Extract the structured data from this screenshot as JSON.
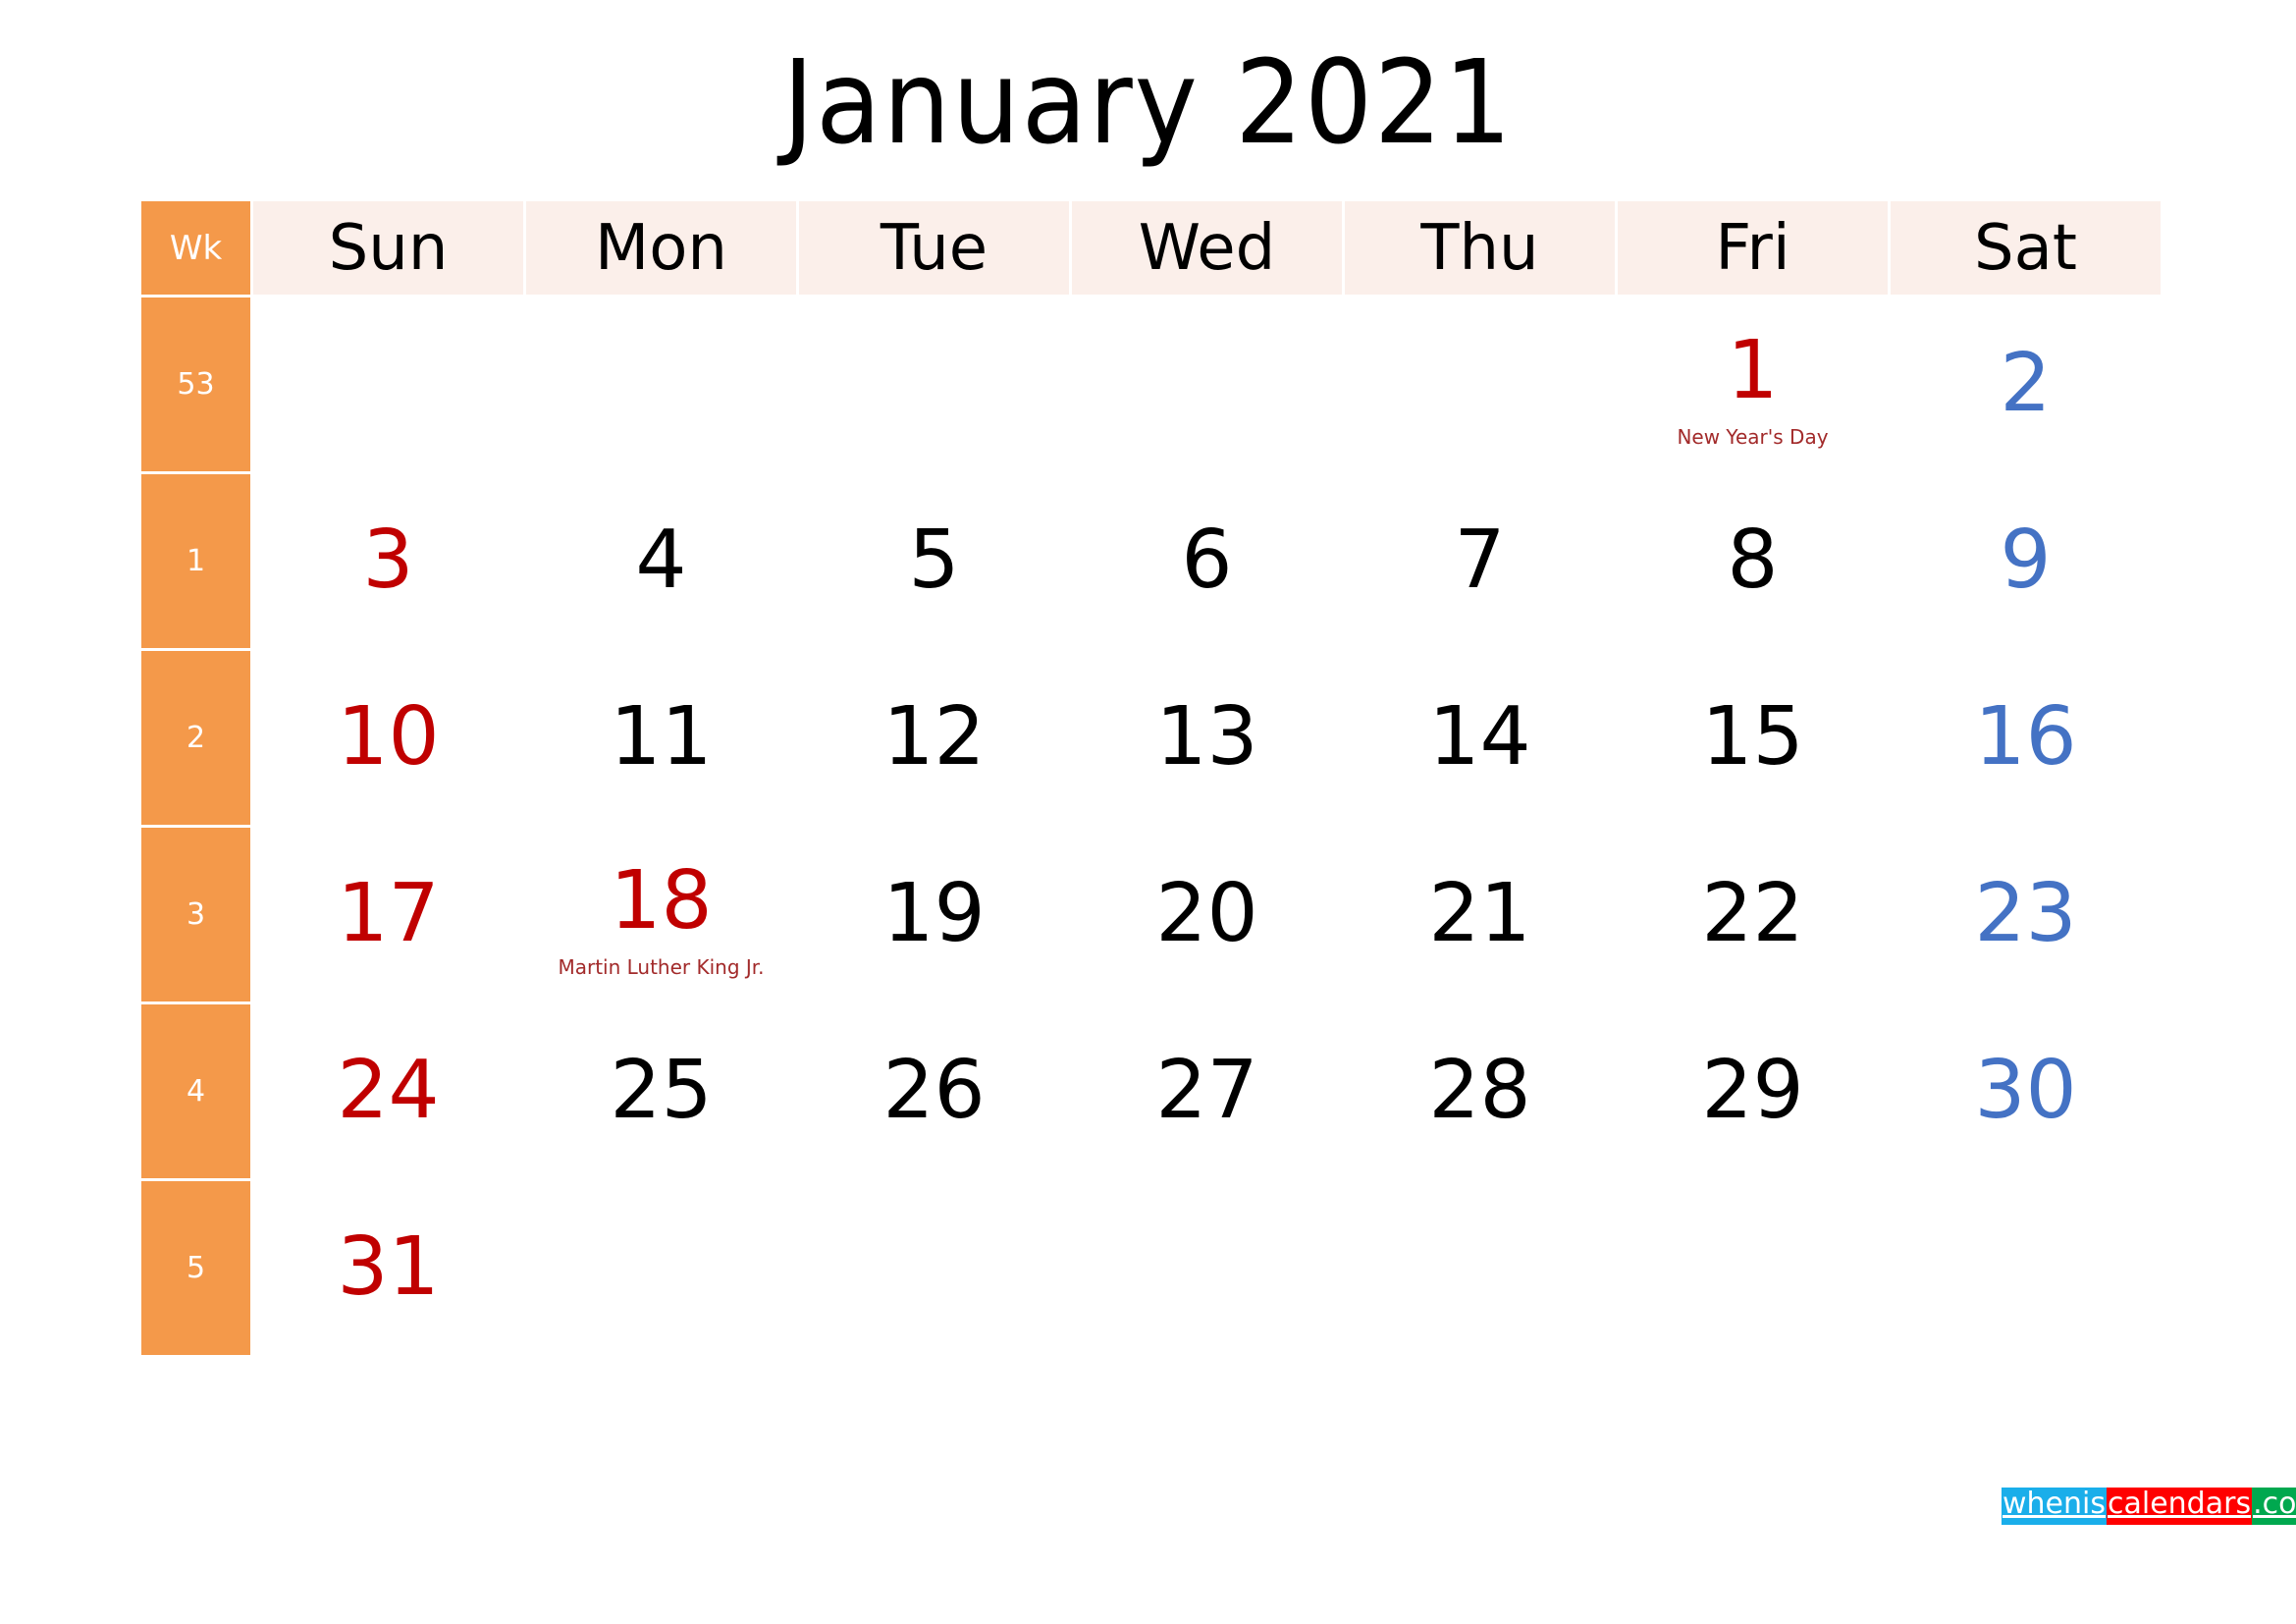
{
  "title": "January 2021",
  "header": {
    "week_label": "Wk",
    "days": [
      "Sun",
      "Mon",
      "Tue",
      "Wed",
      "Thu",
      "Fri",
      "Sat"
    ]
  },
  "weeks": [
    {
      "wk": "53",
      "days": [
        "",
        "",
        "",
        "",
        "",
        "1",
        "2"
      ]
    },
    {
      "wk": "1",
      "days": [
        "3",
        "4",
        "5",
        "6",
        "7",
        "8",
        "9"
      ]
    },
    {
      "wk": "2",
      "days": [
        "10",
        "11",
        "12",
        "13",
        "14",
        "15",
        "16"
      ]
    },
    {
      "wk": "3",
      "days": [
        "17",
        "18",
        "19",
        "20",
        "21",
        "22",
        "23"
      ]
    },
    {
      "wk": "4",
      "days": [
        "24",
        "25",
        "26",
        "27",
        "28",
        "29",
        "30"
      ]
    },
    {
      "wk": "5",
      "days": [
        "31",
        "",
        "",
        "",
        "",
        "",
        ""
      ]
    }
  ],
  "holidays": [
    {
      "week": 0,
      "day": 5,
      "label": "New Year's Day"
    },
    {
      "week": 3,
      "day": 1,
      "label": "Martin Luther King Jr."
    }
  ],
  "colors": {
    "sunday": "#c00000",
    "saturday": "#4472c4",
    "holiday": "#c00000",
    "week_column": "#f4994a",
    "header_bg": "#fbefea"
  },
  "watermark": {
    "part1": "whenis",
    "part2": "calendars",
    "part3": ".com"
  }
}
